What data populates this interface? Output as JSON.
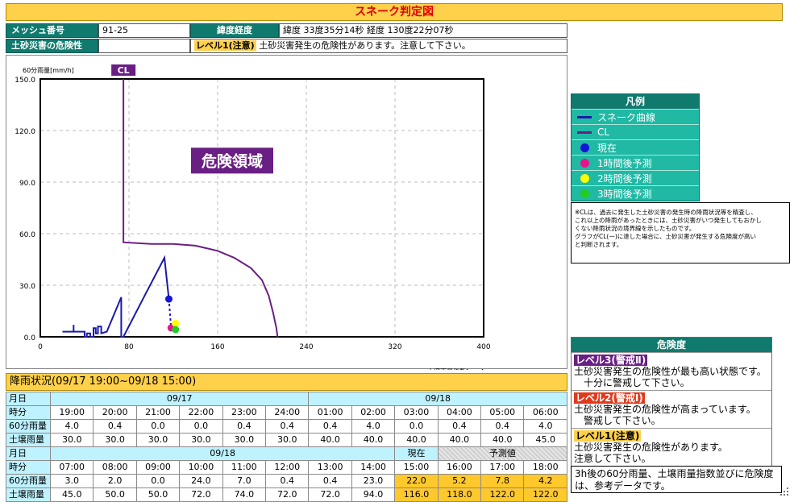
{
  "title": "スネーク判定図",
  "info": {
    "mesh_label": "メッシュ番号",
    "mesh_value": "91-25",
    "latlon_label": "緯度経度",
    "latlon_value": "緯度 33度35分14秒  経度 130度22分07秒",
    "risk_label": "土砂災害の危険性",
    "risk_level": "レベル1(注意)",
    "risk_text": "土砂災害発生の危険性があります。注意して下さい。"
  },
  "chart_data": {
    "type": "line",
    "ylabel": "60分雨量[mm/h]",
    "xlabel": "土壌雨量指数[mm]",
    "xlim": [
      0,
      400
    ],
    "ylim": [
      0,
      150
    ],
    "x_ticks": [
      "0",
      "80",
      "160",
      "240",
      "320",
      "400"
    ],
    "y_ticks": [
      "0.0",
      "30.0",
      "60.0",
      "90.0",
      "120.0",
      "150.0"
    ],
    "grid": true,
    "cl_label": "CL",
    "danger_label": "危険領域",
    "series": [
      {
        "name": "スネーク曲線",
        "color": "#1a1aa8",
        "points": [
          [
            20,
            3
          ],
          [
            30,
            3
          ],
          [
            30,
            7
          ],
          [
            30,
            3
          ],
          [
            40,
            3
          ],
          [
            40,
            0
          ],
          [
            42,
            0
          ],
          [
            42,
            2
          ],
          [
            45,
            2
          ],
          [
            45,
            0
          ],
          [
            48,
            0
          ],
          [
            48,
            5
          ],
          [
            50,
            5
          ],
          [
            50,
            2
          ],
          [
            52,
            2
          ],
          [
            52,
            6
          ],
          [
            55,
            6
          ],
          [
            55,
            2
          ],
          [
            60,
            3
          ],
          [
            73,
            23
          ],
          [
            73,
            0
          ],
          [
            75,
            0
          ],
          [
            95,
            25
          ],
          [
            112,
            46
          ],
          [
            116,
            22
          ]
        ]
      },
      {
        "name": "CL",
        "color": "#6a1f84",
        "points": [
          [
            75,
            150
          ],
          [
            75,
            55
          ],
          [
            100,
            54
          ],
          [
            120,
            54
          ],
          [
            140,
            53
          ],
          [
            160,
            50
          ],
          [
            175,
            46
          ],
          [
            190,
            40
          ],
          [
            200,
            33
          ],
          [
            206,
            24
          ],
          [
            210,
            14
          ],
          [
            213,
            5
          ],
          [
            214,
            0
          ]
        ]
      }
    ],
    "dotted_forecast": [
      [
        116,
        22
      ],
      [
        118,
        5
      ],
      [
        122,
        8
      ],
      [
        124,
        4
      ]
    ],
    "markers": [
      {
        "label": "現在",
        "x": 116,
        "y": 22,
        "color": "#1515d8"
      },
      {
        "label": "1時間後予測",
        "x": 118,
        "y": 5.2,
        "color": "#e8148c"
      },
      {
        "label": "2時間後予測",
        "x": 122,
        "y": 7.8,
        "color": "#ffff00"
      },
      {
        "label": "3時間後予測",
        "x": 122,
        "y": 4.2,
        "color": "#22cc22"
      }
    ]
  },
  "legend": {
    "title": "凡例",
    "items": [
      {
        "label": "スネーク曲線",
        "kind": "line",
        "color": "#1a1aa8"
      },
      {
        "label": "CL",
        "kind": "line",
        "color": "#6a1f84"
      },
      {
        "label": "現在",
        "kind": "dot",
        "color": "#1515d8"
      },
      {
        "label": "1時間後予測",
        "kind": "dot",
        "color": "#e8148c"
      },
      {
        "label": "2時間後予測",
        "kind": "dot",
        "color": "#ffff00"
      },
      {
        "label": "3時間後予測",
        "kind": "dot",
        "color": "#22cc22"
      }
    ]
  },
  "note_lines": [
    "※CLは、過去に発生した土砂災害の発生時の降雨状況等を精査し、",
    "これ以上の降雨があったときには、土砂災害がいつ発生してもおかし",
    "くない降雨状況の境界線を示したものです。",
    "グラフがCL(一)に達した場合に、土砂災害が発生する危険度が高い",
    "と判断されます。"
  ],
  "risk_panel": {
    "title": "危険度",
    "levels": [
      {
        "tag": "レベル3(警戒Ⅱ)",
        "line1": "土砂災害発生の危険性が最も高い状態です。",
        "line2": "十分に警戒して下さい。"
      },
      {
        "tag": "レベル2(警戒Ⅰ)",
        "line1": "土砂災害発生の危険性が高まっています。",
        "line2": "警戒して下さい。"
      },
      {
        "tag": "レベル1(注意)",
        "line1": "土砂災害発生の危険性があります。",
        "line2": "注意して下さい。"
      }
    ]
  },
  "rain": {
    "title": "降雨状況(09/17 19:00~09/18 15:00)",
    "row_labels": {
      "date": "月日",
      "time": "時分",
      "hourly": "60分雨量",
      "soil": "土壌雨量"
    },
    "block1": {
      "dates": [
        "09/17",
        "09/18"
      ],
      "times": [
        "19:00",
        "20:00",
        "21:00",
        "22:00",
        "23:00",
        "24:00",
        "01:00",
        "02:00",
        "03:00",
        "04:00",
        "05:00",
        "06:00"
      ],
      "hourly": [
        "4.0",
        "0.4",
        "0.0",
        "0.0",
        "0.4",
        "0.4",
        "0.4",
        "4.0",
        "0.0",
        "0.4",
        "0.4",
        "4.0"
      ],
      "soil": [
        "30.0",
        "30.0",
        "30.0",
        "30.0",
        "30.0",
        "30.0",
        "40.0",
        "40.0",
        "40.0",
        "40.0",
        "40.0",
        "45.0"
      ]
    },
    "block2": {
      "date": "09/18",
      "now_label": "現在",
      "forecast_label": "予測値",
      "times": [
        "07:00",
        "08:00",
        "09:00",
        "10:00",
        "11:00",
        "12:00",
        "13:00",
        "14:00",
        "15:00",
        "16:00",
        "17:00",
        "18:00"
      ],
      "hourly": [
        "3.0",
        "2.0",
        "0.0",
        "24.0",
        "7.0",
        "0.4",
        "0.4",
        "23.0",
        "22.0",
        "5.2",
        "7.8",
        "4.2"
      ],
      "soil": [
        "45.0",
        "50.0",
        "50.0",
        "72.0",
        "74.0",
        "72.0",
        "72.0",
        "94.0",
        "116.0",
        "118.0",
        "122.0",
        "122.0"
      ]
    }
  },
  "footnote": "3h後の60分雨量、土壌雨量指数並びに危険度は、参考データです。"
}
